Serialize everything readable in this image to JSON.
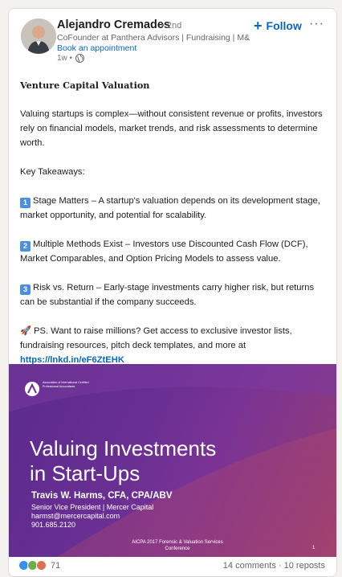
{
  "author": {
    "name": "Alejandro Cremades",
    "degree": "• 2nd",
    "headline": "CoFounder at Panthera Advisors | Fundraising | M&...",
    "appointment_link": "Book an appointment",
    "time": "1w •"
  },
  "actions": {
    "follow_label": "Follow",
    "follow_icon": "+",
    "more_label": "···"
  },
  "post": {
    "title": "Venture Capital Valuation",
    "intro": "Valuing startups is complex—without consistent revenue or profits, investors rely on financial models, market trends, and risk assessments to determine worth.",
    "takeaways_heading": "Key Takeaways:",
    "takeaways": [
      {
        "number": "1",
        "text": "Stage Matters – A startup's valuation depends on its development stage, market opportunity, and potential for scalability."
      },
      {
        "number": "2",
        "text": "Multiple Methods Exist – Investors use Discounted Cash Flow (DCF), Market Comparables, and Option Pricing Models to assess value."
      },
      {
        "number": "3",
        "text": "Risk vs. Return – Early-stage investments carry higher risk, but returns can be substantial if the company succeeds."
      }
    ],
    "ps_emoji": "🚀",
    "ps_text": "PS. Want to raise millions? Get access to exclusive investor lists, fundraising resources, pitch deck templates, and more at",
    "ps_link": "https://lnkd.in/eF6ZtEHK"
  },
  "slide": {
    "org_text": "Association of International Certified Professional Accountants",
    "title_line1": "Valuing Investments",
    "title_line2": "in Start-Ups",
    "presenter": "Travis W. Harms, CFA, CPA/ABV",
    "presenter_role": "Senior Vice President | Mercer Capital",
    "presenter_email": "harmst@mercercapital.com",
    "presenter_phone": "901.685.2120",
    "conference_line1": "AICPA 2017 Forensic & Valuation Services",
    "conference_line2": "Conference",
    "page_number": "1"
  },
  "social": {
    "reaction_count": "71",
    "reaction_colors": [
      "#378fe9",
      "#df704d",
      "#6dae4f"
    ],
    "comments": "14 comments",
    "separator": "·",
    "reposts": "10 reposts"
  },
  "colors": {
    "accent": "#0a66c2"
  }
}
